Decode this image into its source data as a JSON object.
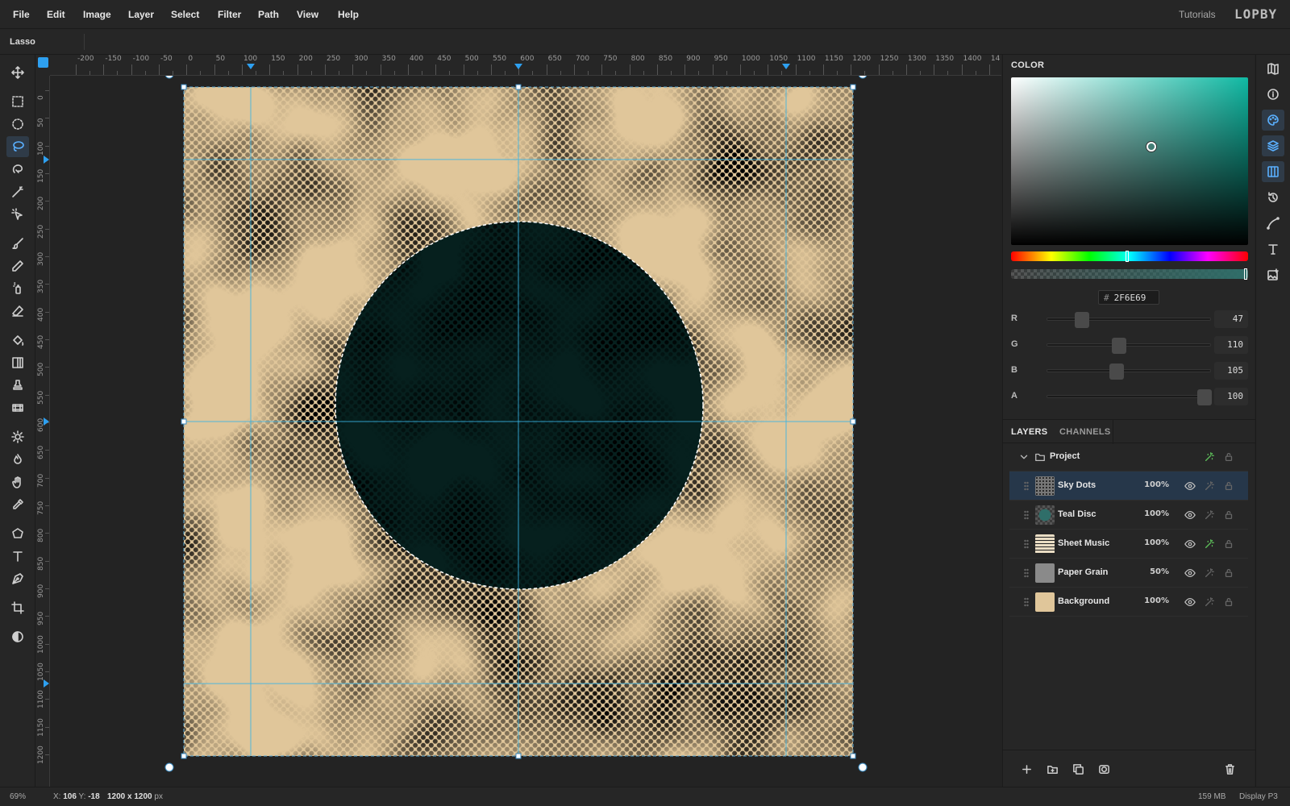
{
  "menu": [
    "File",
    "Edit",
    "Image",
    "Layer",
    "Select",
    "Filter",
    "Path",
    "View",
    "Help"
  ],
  "header": {
    "tutorials": "Tutorials",
    "logo": "LOPBY"
  },
  "options": {
    "tool_name": "Lasso"
  },
  "tools": [
    "move-icon",
    "rect-select-icon",
    "ellipse-select-icon",
    "lasso-icon",
    "quick-select-icon",
    "magic-wand-icon",
    "object-select-icon",
    "brush-icon",
    "pencil-icon",
    "spray-icon",
    "eraser-icon",
    "bucket-icon",
    "gradient-icon",
    "stamp-icon",
    "film-icon",
    "dodge-icon",
    "burn-icon",
    "hand-icon",
    "eyedropper-icon",
    "polygon-icon",
    "text-icon",
    "pen-icon",
    "crop-icon",
    "contrast-icon"
  ],
  "active_tool": "lasso-icon",
  "rulers": {
    "h_labels": [
      "-200",
      "-150",
      "-100",
      "-50",
      "0",
      "50",
      "100",
      "150",
      "200",
      "250",
      "300",
      "350",
      "400",
      "450",
      "500",
      "550",
      "600",
      "650",
      "700",
      "750",
      "800",
      "850",
      "900",
      "950",
      "1000",
      "1050",
      "1100",
      "1150",
      "1200",
      "1250",
      "1300",
      "1350",
      "1400",
      "14"
    ],
    "v_labels": [
      "0",
      "50",
      "100",
      "150",
      "200",
      "250",
      "300",
      "350",
      "400",
      "450",
      "500",
      "550",
      "600",
      "650",
      "700",
      "750",
      "800",
      "850",
      "900",
      "950",
      "1000",
      "1050",
      "1100",
      "1150",
      "1200"
    ]
  },
  "guides": {
    "vertical": [
      120,
      600,
      1080
    ],
    "horizontal": [
      130,
      600,
      1070
    ],
    "units": "px"
  },
  "document": {
    "width": 1200,
    "height": 1200
  },
  "color": {
    "title": "COLOR",
    "hex_prefix": "#",
    "hex": "2F6E69",
    "channels": [
      {
        "label": "R",
        "value": "47",
        "level": 0.184
      },
      {
        "label": "G",
        "value": "110",
        "level": 0.431
      },
      {
        "label": "B",
        "value": "105",
        "level": 0.412
      },
      {
        "label": "A",
        "value": "100",
        "level": 1.0
      }
    ],
    "hue_color": "#10b9a3",
    "swatch": "#2f6e69"
  },
  "layers_panel": {
    "tabs": [
      "LAYERS",
      "CHANNELS"
    ],
    "group": {
      "name": "Project"
    },
    "layers": [
      {
        "name": "Sky Dots",
        "opacity": "100%",
        "selected": true,
        "thumb": "dots"
      },
      {
        "name": "Teal Disc",
        "opacity": "100%",
        "selected": false,
        "thumb": "disc"
      },
      {
        "name": "Sheet Music",
        "opacity": "100%",
        "selected": false,
        "thumb": "music"
      },
      {
        "name": "Paper Grain",
        "opacity": "50%",
        "selected": false,
        "thumb": "grain"
      },
      {
        "name": "Background",
        "opacity": "100%",
        "selected": false,
        "thumb": "bg"
      }
    ],
    "footer_icons": [
      "add-layer-icon",
      "add-group-icon",
      "duplicate-icon",
      "mask-icon",
      "delete-icon"
    ]
  },
  "sidebar_icons": [
    "map-icon",
    "info-icon",
    "palette-icon",
    "layers-icon",
    "columns-icon",
    "history-icon",
    "curve-icon",
    "type-icon",
    "image-edit-icon"
  ],
  "status": {
    "zoom": "69%",
    "x_label": "X:",
    "x": "106",
    "y_label": "Y:",
    "y": "-18",
    "size": "1200 x 1200",
    "size_unit": "px",
    "memory": "159 MB",
    "profile": "Display P3"
  }
}
